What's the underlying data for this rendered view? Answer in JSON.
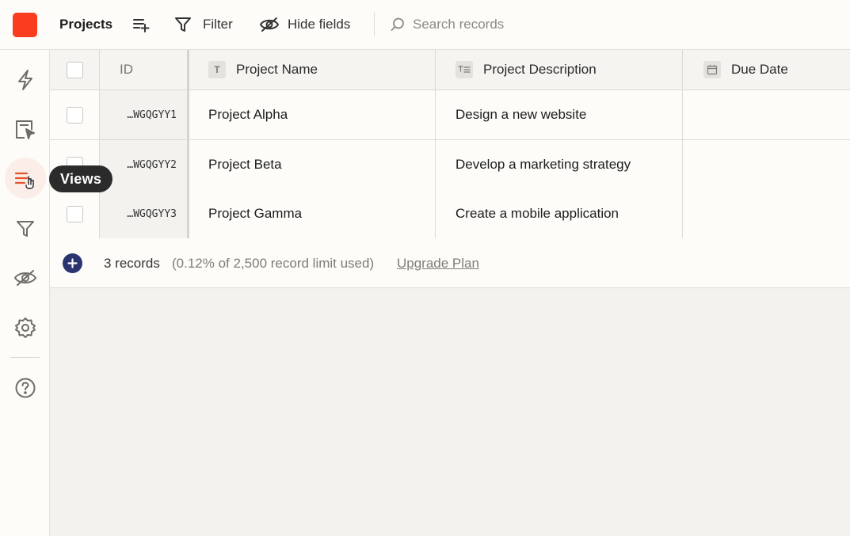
{
  "toolbar": {
    "view_title": "Projects",
    "filter_label": "Filter",
    "hide_fields_label": "Hide fields",
    "search_placeholder": "Search records"
  },
  "colors": {
    "brand": "#fb3d1f",
    "accent_active": "#e4532b",
    "add_button": "#2c3470"
  },
  "sidebar": {
    "items": [
      {
        "icon": "lightning-icon"
      },
      {
        "icon": "interface-icon"
      },
      {
        "icon": "views-icon",
        "active": true
      },
      {
        "icon": "filter-icon"
      },
      {
        "icon": "hide-icon"
      },
      {
        "icon": "settings-icon"
      },
      {
        "icon": "help-icon"
      }
    ],
    "tooltip": "Views"
  },
  "table": {
    "columns": {
      "id": "ID",
      "name": "Project Name",
      "description": "Project Description",
      "due_date": "Due Date"
    },
    "rows": [
      {
        "id": "…WGQGYY1",
        "name": "Project Alpha",
        "description": "Design a new website",
        "due_date": ""
      },
      {
        "id": "…WGQGYY2",
        "name": "Project Beta",
        "description": "Develop a marketing strategy",
        "due_date": ""
      },
      {
        "id": "…WGQGYY3",
        "name": "Project Gamma",
        "description": "Create a mobile application",
        "due_date": ""
      }
    ]
  },
  "footer": {
    "record_count": "3 records",
    "record_limit": "(0.12% of 2,500 record limit used)",
    "upgrade_link": "Upgrade Plan"
  }
}
